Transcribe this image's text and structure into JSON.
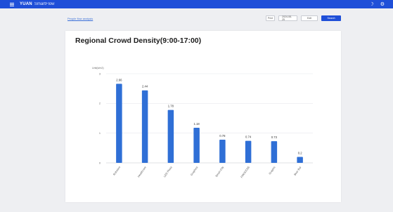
{
  "app": {
    "name": "YUAN",
    "subtitle": "SmartFlow"
  },
  "header": {
    "icons": [
      "moon-icon",
      "settings-icon"
    ]
  },
  "breadcrumb": "People flow analysis",
  "toolbar": {
    "buttons": [
      "Print",
      "2024-08-25",
      "Edit",
      "Search"
    ]
  },
  "colors": {
    "accent": "#1f4fd8",
    "bar": "#2f6fd6"
  },
  "chart_data": {
    "type": "bar",
    "title": "Regional Crowd Density(9:00-17:00)",
    "ylabel": "Unit(k/m2)",
    "xlabel": "",
    "ylim": [
      0,
      3
    ],
    "yticks": [
      0,
      1,
      2,
      3
    ],
    "grid": true,
    "categories": [
      "Robotics",
      "Healthcare",
      "LED Plaza",
      "Graphics",
      "Smart City",
      "FMOCCSS",
      "Graphic",
      "Beer Bar"
    ],
    "values": [
      2.66,
      2.44,
      1.78,
      1.18,
      0.78,
      0.74,
      0.73,
      0.2
    ],
    "value_labels": [
      "2.66",
      "2.44",
      "1.78",
      "1.18",
      "0.78",
      "0.74",
      "0.73",
      "0.2"
    ]
  }
}
